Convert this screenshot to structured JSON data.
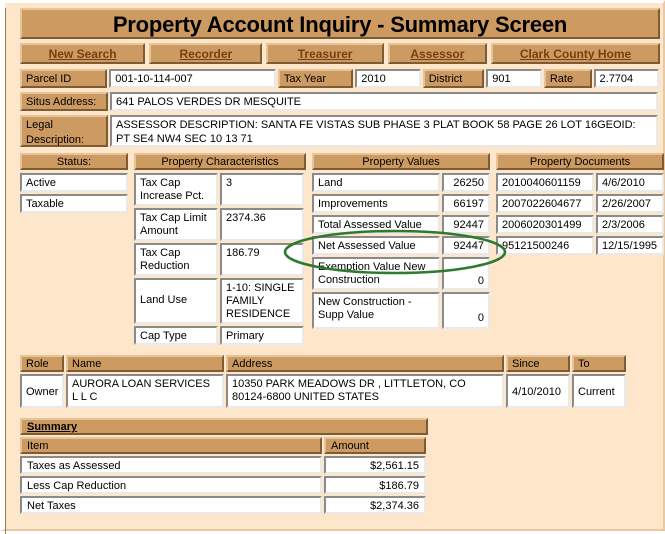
{
  "header": {
    "title": "Property Account Inquiry - Summary Screen"
  },
  "nav": {
    "items": [
      {
        "label": "New Search",
        "name": "nav-new-search"
      },
      {
        "label": "Recorder",
        "name": "nav-recorder"
      },
      {
        "label": "Treasurer",
        "name": "nav-treasurer"
      },
      {
        "label": "Assessor",
        "name": "nav-assessor"
      },
      {
        "label": "Clark County Home",
        "name": "nav-clark-county-home"
      }
    ]
  },
  "parcel": {
    "parcel_id_label": "Parcel ID",
    "parcel_id_value": "001-10-114-007",
    "tax_year_label": "Tax Year",
    "tax_year_value": "2010",
    "district_label": "District",
    "district_value": "901",
    "rate_label": "Rate",
    "rate_value": "2.7704",
    "situs_label": "Situs Address:",
    "situs_value": "641 PALOS VERDES DR MESQUITE",
    "legal_label": "Legal Description:",
    "legal_value": "ASSESSOR DESCRIPTION: SANTA FE VISTAS SUB PHASE 3 PLAT BOOK 58 PAGE 26 LOT 16GEOID: PT SE4 NW4 SEC 10 13 71"
  },
  "status": {
    "heading": "Status:",
    "items": [
      "Active",
      "Taxable"
    ]
  },
  "characteristics": {
    "heading": "Property Characteristics",
    "rows": [
      {
        "label": "Tax Cap Increase Pct.",
        "value": "3"
      },
      {
        "label": "Tax Cap Limit Amount",
        "value": "2374.36"
      },
      {
        "label": "Tax Cap Reduction",
        "value": "186.79"
      },
      {
        "label": "Land Use",
        "value": "1-10: SINGLE FAMILY RESIDENCE"
      },
      {
        "label": "Cap Type",
        "value": "Primary"
      }
    ]
  },
  "values": {
    "heading": "Property Values",
    "rows": [
      {
        "label": "Land",
        "value": "26250"
      },
      {
        "label": "Improvements",
        "value": "66197"
      },
      {
        "label": "Total Assessed Value",
        "value": "92447"
      },
      {
        "label": "Net Assessed Value",
        "value": "92447"
      },
      {
        "label": "Exemption Value New Construction",
        "value": "0"
      },
      {
        "label": "New Construction - Supp Value",
        "value": "0"
      }
    ]
  },
  "documents": {
    "heading": "Property Documents",
    "rows": [
      {
        "number": "2010040601159",
        "date": "4/6/2010"
      },
      {
        "number": "2007022604677",
        "date": "2/26/2007"
      },
      {
        "number": "2006020301499",
        "date": "2/3/2006"
      },
      {
        "number": "95121500246",
        "date": "12/15/1995"
      }
    ]
  },
  "owners": {
    "columns": [
      "Role",
      "Name",
      "Address",
      "Since",
      "To"
    ],
    "rows": [
      {
        "role": "Owner",
        "name": "AURORA LOAN SERVICES L L C",
        "address": "10350 PARK MEADOWS DR , LITTLETON, CO 80124-6800 UNITED STATES",
        "since": "4/10/2010",
        "to": "Current"
      }
    ]
  },
  "summary": {
    "title": "Summary",
    "columns": [
      "Item",
      "Amount"
    ],
    "rows": [
      {
        "item": "Taxes as Assessed",
        "amount": "$2,561.15"
      },
      {
        "item": "Less Cap Reduction",
        "amount": "$186.79"
      },
      {
        "item": "Net Taxes",
        "amount": "$2,374.36"
      }
    ]
  },
  "annotation": {
    "kind": "ellipse-highlight",
    "color": "#2f7a2f",
    "target": "Net Assessed Value"
  },
  "colors": {
    "page_background": "#fde6ca",
    "header_tan": "#cd9b62",
    "link_text": "#7a3d10",
    "highlight_green": "#2f7a2f"
  }
}
